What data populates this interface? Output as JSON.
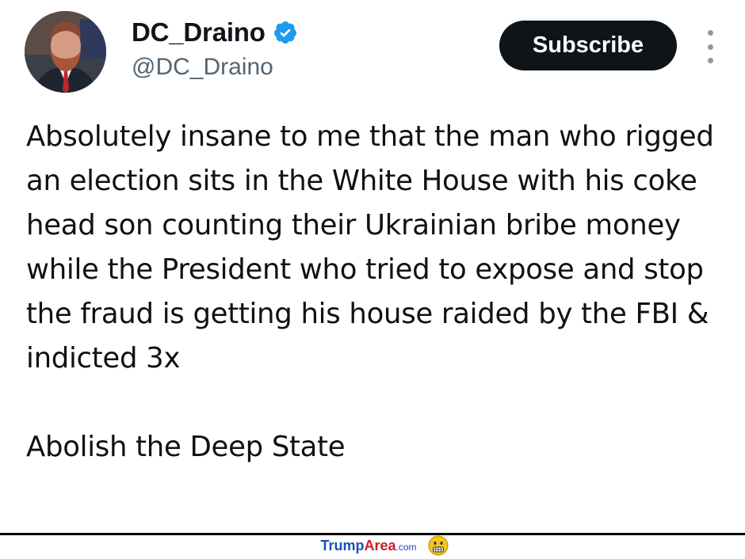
{
  "profile": {
    "display_name": "DC_Draino",
    "handle": "@DC_Draino",
    "verified": true,
    "verified_color": "#1d9bf0"
  },
  "actions": {
    "subscribe_label": "Subscribe",
    "more_icon": "more-vertical-icon"
  },
  "tweet": {
    "paragraph_1": "Absolutely insane to me that the man who rigged an election sits in the White House with his coke head son counting their Ukrainian bribe money while the President who tried to expose and stop the fraud is getting his house raided by the FBI & indicted 3x",
    "paragraph_2": "Abolish the Deep State"
  },
  "watermark": {
    "part_1": "Trump",
    "part_2": "Area",
    "part_3": ".com",
    "icon": "grimace-emoji-icon"
  },
  "colors": {
    "subscribe_bg": "#0f1419",
    "handle": "#536471",
    "watermark_blue": "#1f4fb8",
    "watermark_red": "#c8202a"
  }
}
